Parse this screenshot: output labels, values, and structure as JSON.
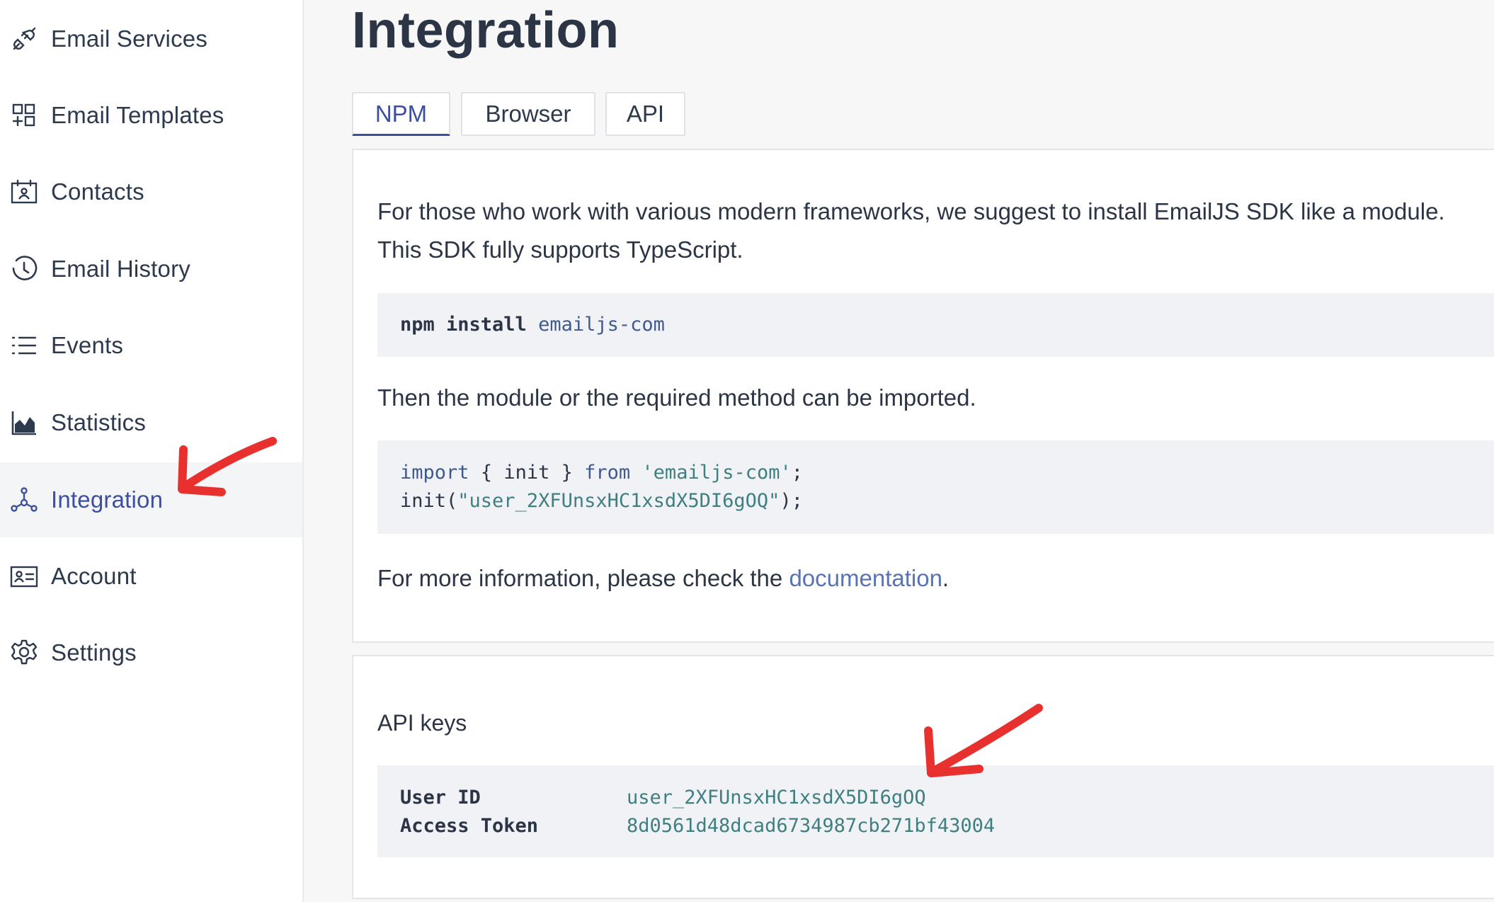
{
  "sidebar": {
    "items": [
      {
        "label": "Email Services",
        "icon": "plug-icon",
        "active": false
      },
      {
        "label": "Email Templates",
        "icon": "templates-grid-icon",
        "active": false
      },
      {
        "label": "Contacts",
        "icon": "contacts-calendar-icon",
        "active": false
      },
      {
        "label": "Email History",
        "icon": "history-clock-icon",
        "active": false
      },
      {
        "label": "Events",
        "icon": "list-icon",
        "active": false
      },
      {
        "label": "Statistics",
        "icon": "area-chart-icon",
        "active": false
      },
      {
        "label": "Integration",
        "icon": "integration-nodes-icon",
        "active": true
      },
      {
        "label": "Account",
        "icon": "id-card-icon",
        "active": false
      },
      {
        "label": "Settings",
        "icon": "gear-icon",
        "active": false
      }
    ]
  },
  "page": {
    "title": "Integration",
    "tabs": [
      "NPM",
      "Browser",
      "API"
    ],
    "active_tab": "NPM"
  },
  "npm_panel": {
    "intro_line1": "For those who work with various modern frameworks, we suggest to install EmailJS SDK like a module.",
    "intro_line2": "This SDK fully supports TypeScript.",
    "install_cmd": "npm install",
    "install_pkg": "emailjs-com",
    "import_text": "Then the module or the required method can be imported.",
    "code_import_kw": "import",
    "code_braces": "{ init }",
    "code_from_kw": "from",
    "code_module": "'emailjs-com'",
    "code_semicolon": ";",
    "code_init_call": "init(",
    "code_init_arg": "\"user_2XFUnsxHC1xsdX5DI6gOQ\"",
    "code_init_end": ");",
    "more_info_prefix": "For more information, please check the",
    "more_info_link": "documentation",
    "more_info_suffix": "."
  },
  "api_keys": {
    "title": "API keys",
    "user_id_label": "User ID",
    "user_id_value": "user_2XFUnsxHC1xsdX5DI6gOQ",
    "access_token_label": "Access Token",
    "access_token_value": "8d0561d48dcad6734987cb271bf43004"
  },
  "colors": {
    "accent": "#3d4f9f",
    "annotation_arrow": "#e8302e",
    "code_bg": "#f1f2f6",
    "code_value": "#3f7f80"
  }
}
